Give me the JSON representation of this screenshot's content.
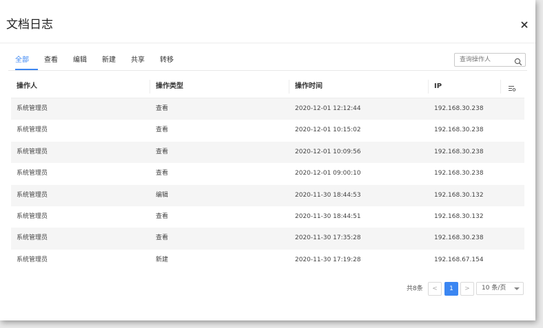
{
  "dialog": {
    "title": "文档日志"
  },
  "tabs": [
    {
      "label": "全部",
      "active": true
    },
    {
      "label": "查看",
      "active": false
    },
    {
      "label": "编辑",
      "active": false
    },
    {
      "label": "新建",
      "active": false
    },
    {
      "label": "共享",
      "active": false
    },
    {
      "label": "转移",
      "active": false
    }
  ],
  "search": {
    "placeholder": "查询操作人",
    "value": "",
    "icon": "search-icon"
  },
  "table": {
    "columns": [
      "操作人",
      "操作类型",
      "操作时间",
      "IP"
    ],
    "rows": [
      {
        "operator": "系统管理员",
        "type": "查看",
        "time": "2020-12-01 12:12:44",
        "ip": "192.168.30.238"
      },
      {
        "operator": "系统管理员",
        "type": "查看",
        "time": "2020-12-01 10:15:02",
        "ip": "192.168.30.238"
      },
      {
        "operator": "系统管理员",
        "type": "查看",
        "time": "2020-12-01 10:09:56",
        "ip": "192.168.30.238"
      },
      {
        "operator": "系统管理员",
        "type": "查看",
        "time": "2020-12-01 09:00:10",
        "ip": "192.168.30.238"
      },
      {
        "operator": "系统管理员",
        "type": "编辑",
        "time": "2020-11-30 18:44:53",
        "ip": "192.168.30.132"
      },
      {
        "operator": "系统管理员",
        "type": "查看",
        "time": "2020-11-30 18:44:51",
        "ip": "192.168.30.132"
      },
      {
        "operator": "系统管理员",
        "type": "查看",
        "time": "2020-11-30 17:35:28",
        "ip": "192.168.30.238"
      },
      {
        "operator": "系统管理员",
        "type": "新建",
        "time": "2020-11-30 17:19:28",
        "ip": "192.168.67.154"
      }
    ]
  },
  "pagination": {
    "total_label": "共8条",
    "prev": "<",
    "current": "1",
    "next": ">",
    "page_size": "10 条/页"
  },
  "colors": {
    "accent": "#3b86f2",
    "stripe": "#f5f5f5"
  }
}
